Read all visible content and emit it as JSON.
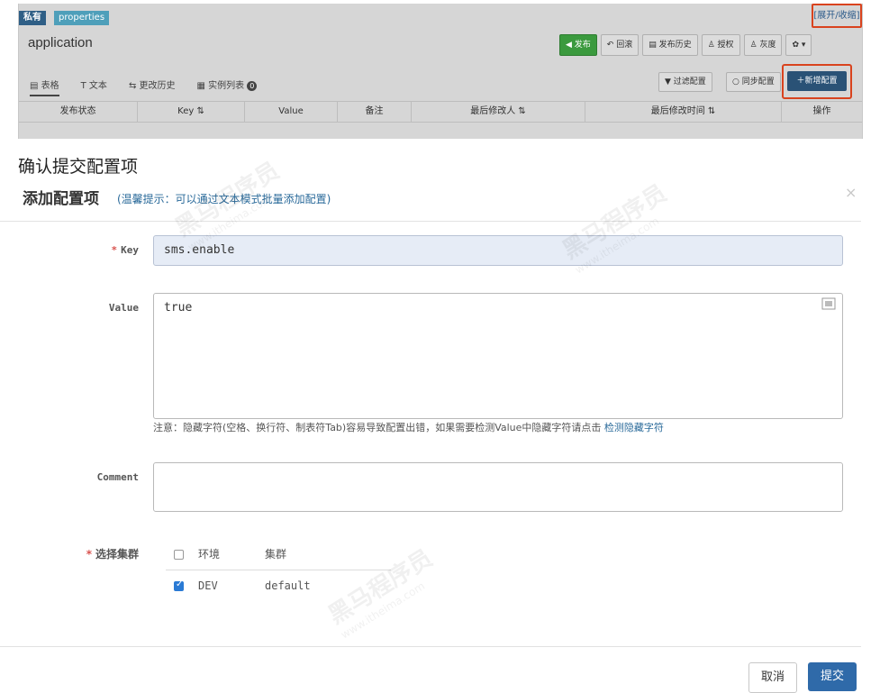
{
  "top": {
    "tags": [
      "私有",
      "properties"
    ],
    "expand_toggle": "[展开/收缩]",
    "app_name": "application",
    "toolbar": [
      "◀ 发布",
      "↶ 回滚",
      "▤ 发布历史",
      "♙ 授权",
      "♙ 灰度",
      "✿ ▾"
    ],
    "tabs": [
      "▤ 表格",
      "T 文本",
      "⇆ 更改历史",
      "▦ 实例列表"
    ],
    "instance_count": "0",
    "filter_label": "▼ 过滤配置",
    "sync_label": "○ 同步配置",
    "add_label": "＋新增配置",
    "columns": [
      "发布状态",
      "Key ⇅",
      "Value",
      "备注",
      "最后修改人 ⇅",
      "最后修改时间 ⇅",
      "操作"
    ]
  },
  "modal": {
    "confirm_title": "确认提交配置项",
    "title": "添加配置项",
    "tip": "(温馨提示：可以通过文本模式批量添加配置)",
    "close": "×",
    "key_label": "Key",
    "key_value": "sms.enable",
    "value_label": "Value",
    "value_text": "true",
    "note": "注意：隐藏字符(空格、换行符、制表符Tab)容易导致配置出错，如果需要检测Value中隐藏字符请点击",
    "note_link": "检测隐藏字符",
    "comment_label": "Comment",
    "cluster_label": "选择集群",
    "cluster_header": {
      "env": "环境",
      "cluster": "集群"
    },
    "clusters": [
      {
        "env": "DEV",
        "cluster": "default",
        "checked": true
      }
    ],
    "cancel": "取消",
    "submit": "提交"
  },
  "watermark": {
    "brand": "黑马程序员",
    "site": "www.itheima.com"
  }
}
